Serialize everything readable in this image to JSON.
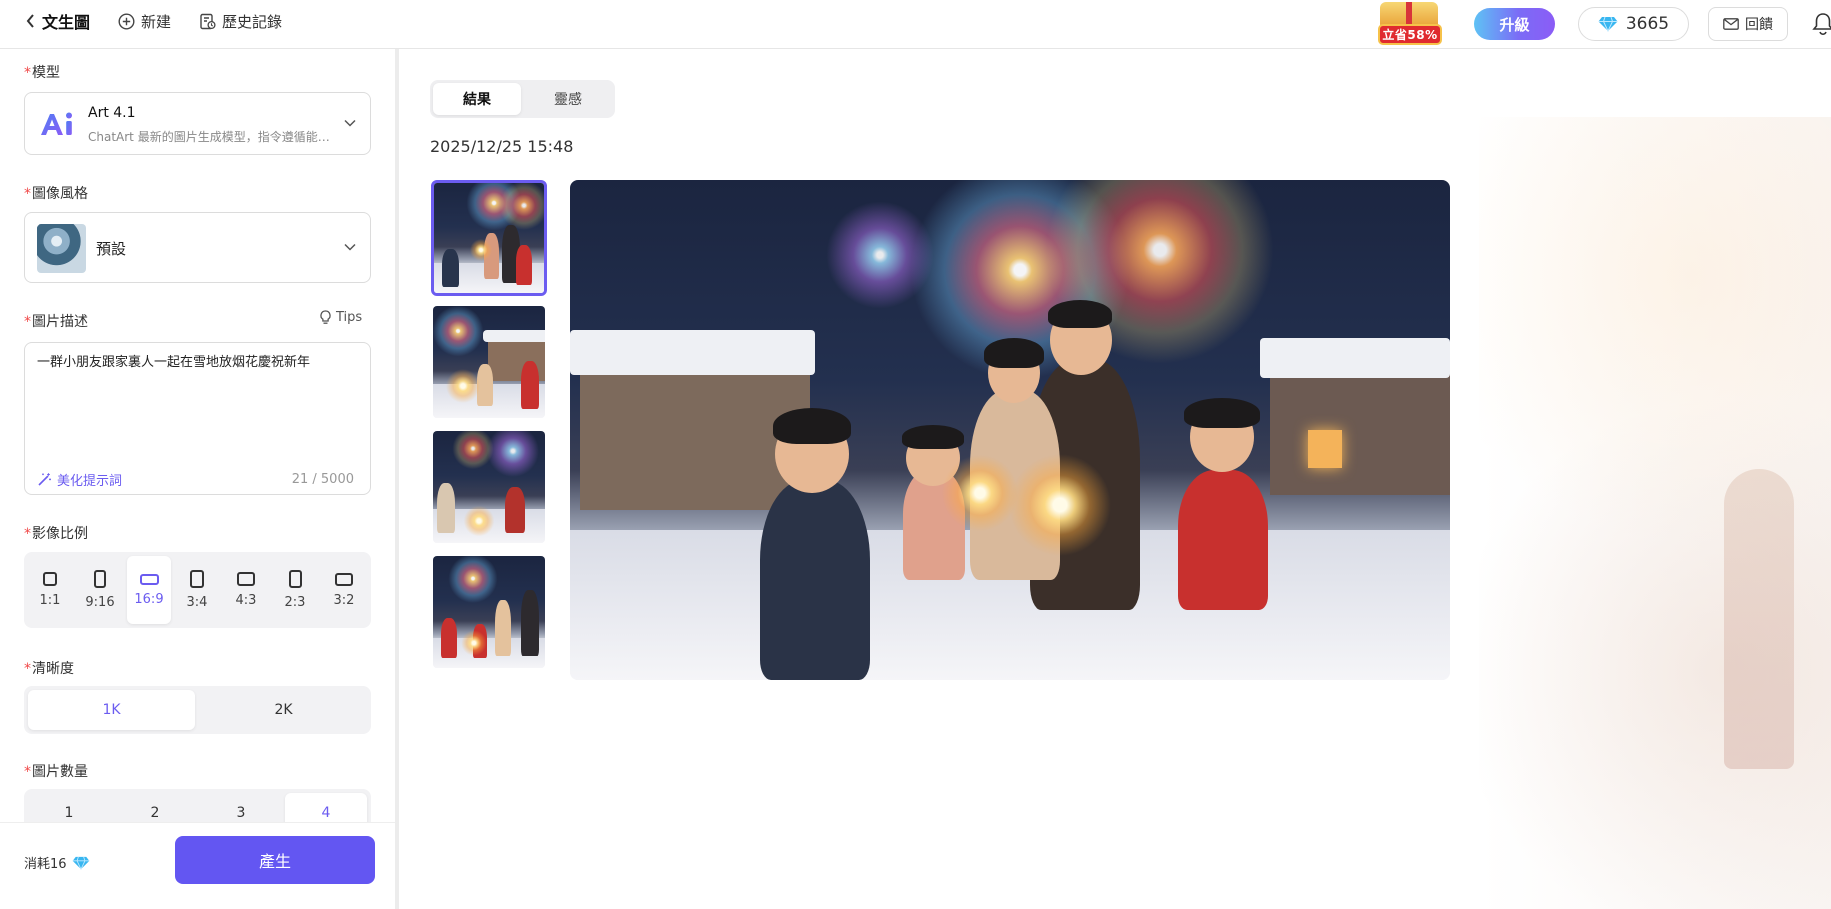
{
  "topbar": {
    "back_title": "文生圖",
    "new_label": "新建",
    "history_label": "歷史記錄",
    "promo_badge": "立省58%",
    "upgrade_label": "升級",
    "credits": "3665",
    "feedback_label": "回饋"
  },
  "form": {
    "required_mark": "*",
    "model": {
      "label": "模型",
      "name": "Art 4.1",
      "description": "ChatArt 最新的圖片生成模型，指令遵循能…"
    },
    "style": {
      "label": "圖像風格",
      "value": "預設"
    },
    "description": {
      "label": "圖片描述",
      "tips_label": "Tips",
      "text": "一群小朋友跟家裏人一起在雪地放烟花慶祝新年",
      "enhance_label": "美化提示詞",
      "counter": "21 / 5000"
    },
    "ratio": {
      "label": "影像比例",
      "options": [
        "1:1",
        "9:16",
        "16:9",
        "3:4",
        "4:3",
        "2:3",
        "3:2"
      ],
      "selected": "16:9"
    },
    "clarity": {
      "label": "清晰度",
      "options": [
        "1K",
        "2K"
      ],
      "selected": "1K"
    },
    "count": {
      "label": "圖片數量",
      "options": [
        "1",
        "2",
        "3",
        "4"
      ],
      "selected": "4"
    }
  },
  "footer": {
    "cost_label": "消耗16",
    "generate_label": "產生"
  },
  "results": {
    "tabs": [
      "結果",
      "靈感"
    ],
    "active_tab": "結果",
    "timestamp": "2025/12/25 15:48",
    "selected_thumbnail": 1
  },
  "colors": {
    "accent": "#6356f2",
    "accent_text": "#6b5cf0",
    "required": "#f04747"
  }
}
